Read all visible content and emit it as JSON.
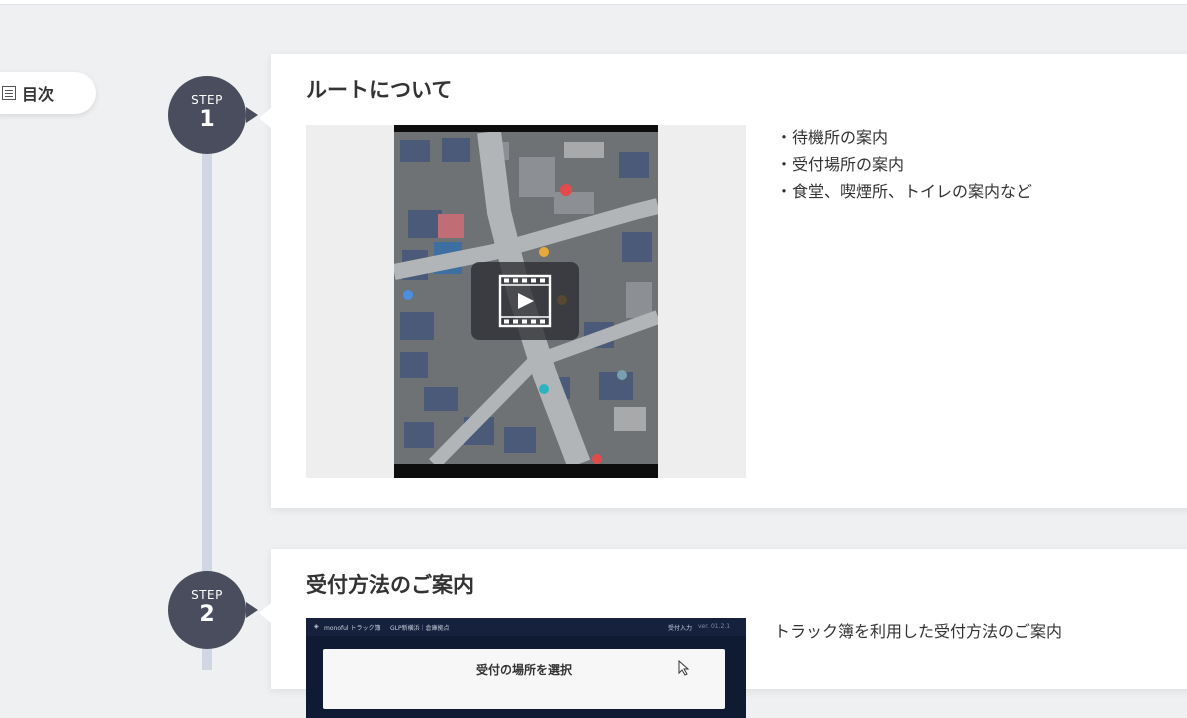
{
  "toc": {
    "label": "目次",
    "icon": "list-icon"
  },
  "steps": [
    {
      "badge_label": "STEP",
      "number": "1",
      "title": "ルートについて",
      "bullets": [
        "待機所の案内",
        "受付場所の案内",
        "食堂、喫煙所、トイレの案内など"
      ]
    },
    {
      "badge_label": "STEP",
      "number": "2",
      "title": "受付方法のご案内",
      "description": "トラック簿を利用した受付方法のご案内",
      "video_screen": {
        "app_name": "monoful トラック簿",
        "location": "GLP新横浜｜倉庫拠点",
        "menu": "受付入力",
        "version": "ver. 01.2.1",
        "panel_title": "受付の場所を選択"
      }
    }
  ],
  "colors": {
    "badge": "#4a4d5d",
    "timeline": "#d0d6e2",
    "background": "#eef0f2"
  }
}
